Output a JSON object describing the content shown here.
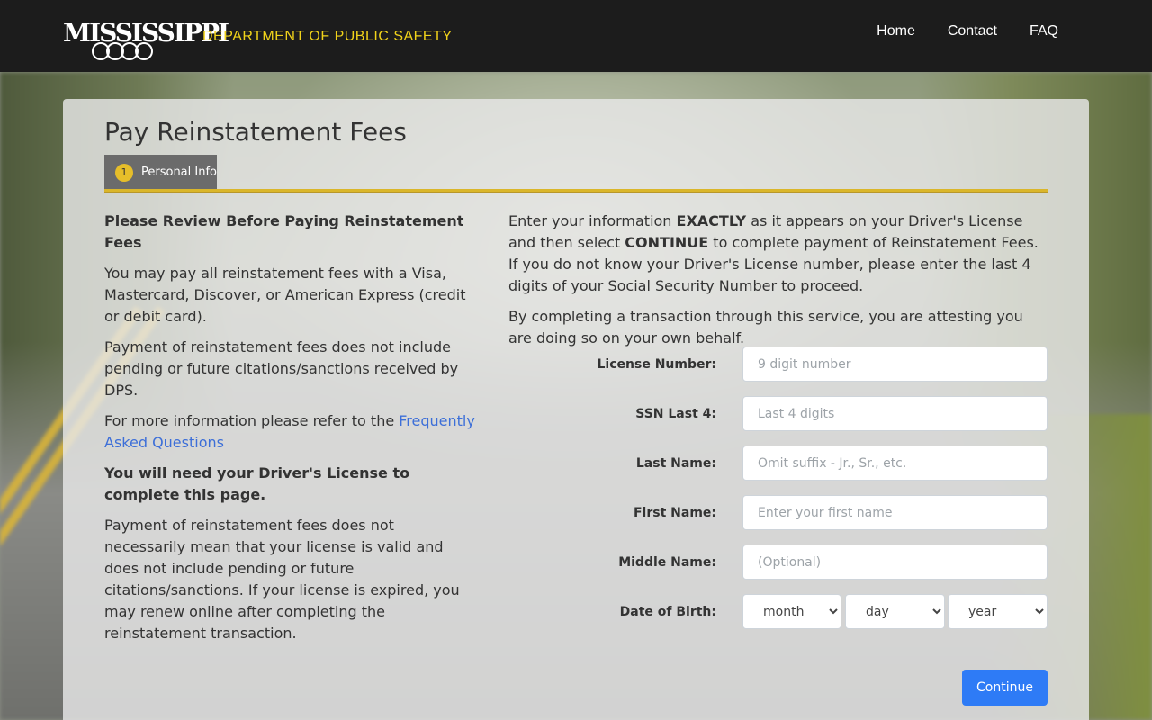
{
  "header": {
    "logo_text": "MISSISSIPPI",
    "dept_text": "DEPARTMENT OF PUBLIC SAFETY",
    "nav": [
      "Home",
      "Contact",
      "FAQ"
    ]
  },
  "page": {
    "title": "Pay Reinstatement Fees",
    "step": {
      "number": "1",
      "label": "Personal Info"
    }
  },
  "left": {
    "heading": "Please Review Before Paying Reinstatement Fees",
    "p1": "You may pay all reinstatement fees with a Visa, Mastercard, Discover, or American Express (credit or debit card).",
    "p2": "Payment of reinstatement fees does not include pending or future citations/sanctions received by DPS.",
    "p3_prefix": "For more information please refer to the ",
    "p3_link": "Frequently Asked Questions",
    "need_license": "You will need your Driver's License to complete this page.",
    "p4": "Payment of reinstatement fees does not necessarily mean that your license is valid and does not include pending or future citations/sanctions. If your license is expired, you may renew online after completing the reinstatement transaction."
  },
  "right": {
    "intro_1": "Enter your information ",
    "intro_exactly": "EXACTLY",
    "intro_2": " as it appears on your Driver's License and then select ",
    "intro_continue": "CONTINUE",
    "intro_3": " to complete payment of Reinstatement Fees. If you do not know your Driver's License number, please enter the last 4 digits of your Social Security Number to proceed.",
    "attest": "By completing a transaction through this service, you are attesting you are doing so on your own behalf."
  },
  "form": {
    "license": {
      "label": "License Number:",
      "placeholder": "9 digit number",
      "value": ""
    },
    "ssn": {
      "label": "SSN Last 4:",
      "placeholder": "Last 4 digits",
      "value": ""
    },
    "last_name": {
      "label": "Last Name:",
      "placeholder": "Omit suffix - Jr., Sr., etc.",
      "value": ""
    },
    "first_name": {
      "label": "First Name:",
      "placeholder": "Enter your first name",
      "value": ""
    },
    "middle_name": {
      "label": "Middle Name:",
      "placeholder": "(Optional)",
      "value": ""
    },
    "dob": {
      "label": "Date of Birth:",
      "month": "month",
      "day": "day",
      "year": "year"
    },
    "submit_label": "Continue"
  },
  "colors": {
    "header_bg": "#1c1c1c",
    "dept_yellow": "#f1d31a",
    "accent_rule": "#dab62a",
    "link": "#3d6fd8",
    "button": "#2e7bf6"
  }
}
